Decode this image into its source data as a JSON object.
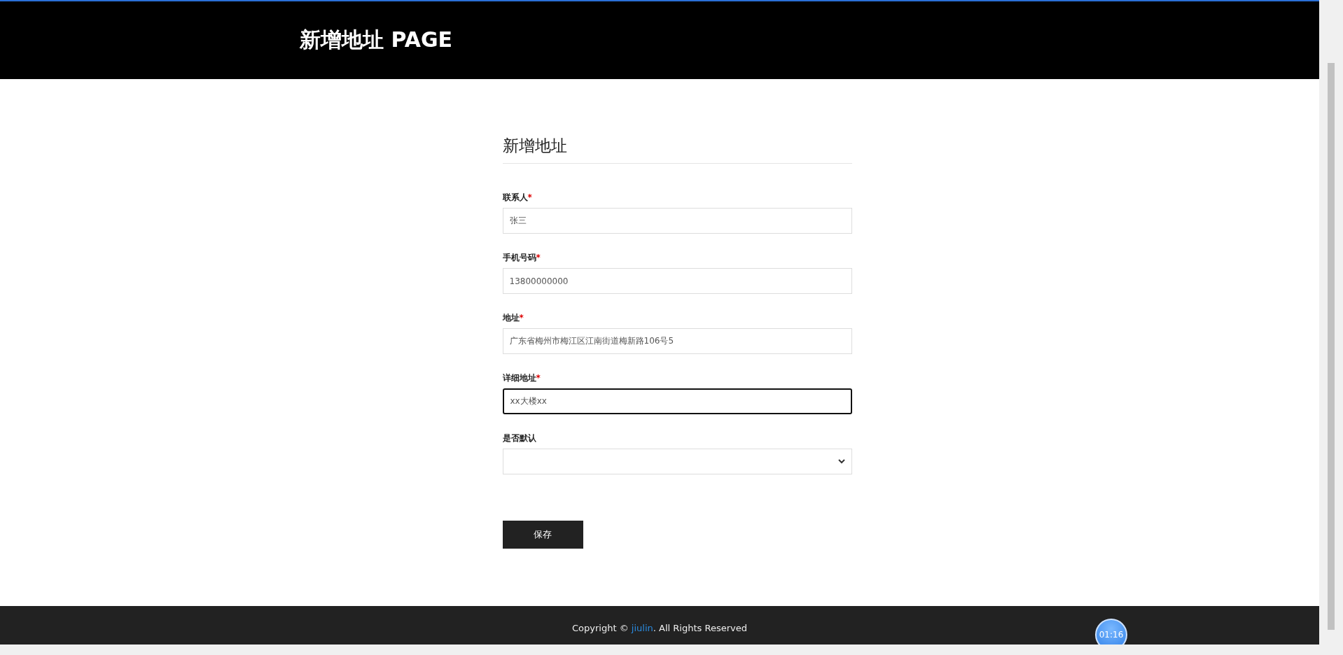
{
  "header": {
    "title": "新增地址 PAGE"
  },
  "form": {
    "title": "新增地址",
    "fields": [
      {
        "kind": "text",
        "label": "联系人",
        "required_mark": "*",
        "value": "张三",
        "focused": false
      },
      {
        "kind": "text",
        "label": "手机号码",
        "required_mark": "*",
        "value": "13800000000",
        "focused": false
      },
      {
        "kind": "text",
        "label": "地址",
        "required_mark": "*",
        "value": "广东省梅州市梅江区江南街道梅新路106号5",
        "focused": false
      },
      {
        "kind": "text",
        "label": "详细地址",
        "required_mark": "*",
        "value": "xx大楼xx",
        "focused": true
      },
      {
        "kind": "select",
        "label": "是否默认",
        "focused": false
      }
    ],
    "submit": "保存"
  },
  "footer": {
    "before": "Copyright © ",
    "link": "jiulin",
    "after": ". All Rights Reserved"
  },
  "timer": "01:16"
}
